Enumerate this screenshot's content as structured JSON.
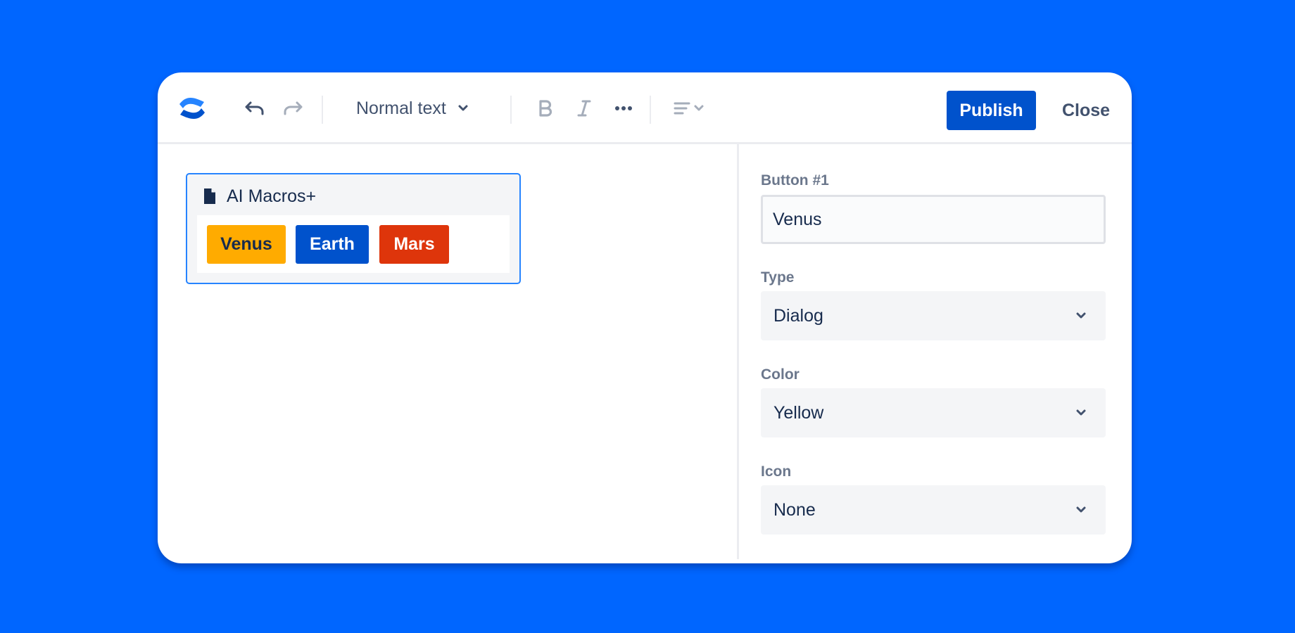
{
  "theme": {
    "background": "#0066ff",
    "accent": "#0052cc",
    "selection_border": "#2684ff"
  },
  "toolbar": {
    "logo_icon": "confluence-logo-icon",
    "undo_icon": "undo-icon",
    "redo_icon": "redo-icon",
    "text_style": "Normal text",
    "bold_icon": "bold-icon",
    "italic_icon": "italic-icon",
    "more_icon": "more-horizontal-icon",
    "alignment_icon": "align-left-icon",
    "publish_label": "Publish",
    "close_label": "Close"
  },
  "editor": {
    "macro": {
      "title": "AI Macros+",
      "icon": "document-icon",
      "buttons": [
        {
          "label": "Venus",
          "color": "#ffab00",
          "text_color": "#172b4d"
        },
        {
          "label": "Earth",
          "color": "#0052cc",
          "text_color": "#ffffff"
        },
        {
          "label": "Mars",
          "color": "#de350b",
          "text_color": "#ffffff"
        }
      ]
    }
  },
  "panel": {
    "button_label_field": {
      "label": "Button #1",
      "value": "Venus"
    },
    "type_field": {
      "label": "Type",
      "value": "Dialog"
    },
    "color_field": {
      "label": "Color",
      "value": "Yellow"
    },
    "icon_field": {
      "label": "Icon",
      "value": "None"
    }
  }
}
